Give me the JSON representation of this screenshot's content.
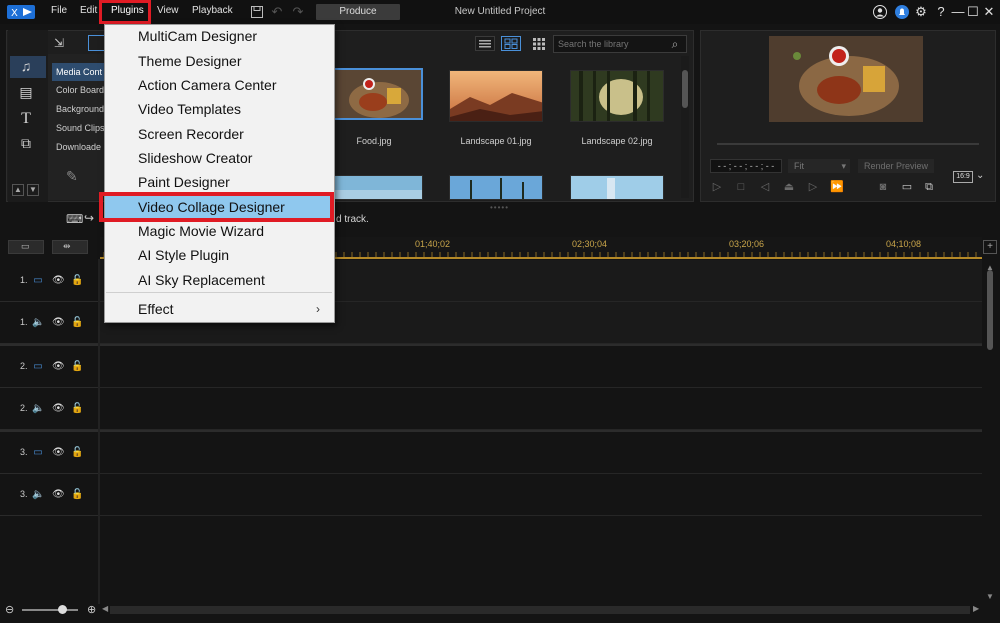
{
  "menubar": {
    "items": [
      "File",
      "Edit",
      "Plugins",
      "View",
      "Playback"
    ],
    "produce_label": "Produce",
    "project_title": "New Untitled Project"
  },
  "plugins_menu": {
    "items": [
      "MultiCam Designer",
      "Theme Designer",
      "Action Camera Center",
      "Video Templates",
      "Screen Recorder",
      "Slideshow Creator",
      "Paint Designer",
      "Video Collage Designer",
      "Magic Movie Wizard",
      "AI Style Plugin",
      "AI Sky Replacement"
    ],
    "selected": "Video Collage Designer",
    "submenu_label": "Effect",
    "submenu_arrow": "›"
  },
  "library": {
    "categories": [
      "Media Cont",
      "Color Board",
      "Background",
      "Sound Clips",
      "Downloade"
    ],
    "search_placeholder": "Search the library",
    "thumbs": [
      {
        "caption": "Food.jpg"
      },
      {
        "caption": "Landscape 01.jpg"
      },
      {
        "caption": "Landscape 02.jpg"
      }
    ],
    "hint": "d track."
  },
  "preview": {
    "timecode": "- - ; - - ; - - ; - -",
    "fit_label": "Fit",
    "render_label": "Render Preview",
    "ratio_label": "16:9"
  },
  "timeline": {
    "tick_labels": [
      "01;40;02",
      "02;30;04",
      "03;20;06",
      "04;10;08"
    ],
    "tracks": [
      {
        "num": "1.",
        "type": "video"
      },
      {
        "num": "1.",
        "type": "audio"
      },
      {
        "num": "2.",
        "type": "video"
      },
      {
        "num": "2.",
        "type": "audio"
      },
      {
        "num": "3.",
        "type": "video"
      },
      {
        "num": "3.",
        "type": "audio"
      }
    ]
  },
  "colors": {
    "accent": "#4a90d9",
    "highlight_red": "#e01b24",
    "menu_selected": "#8fc8ee",
    "ruler": "#b58a28"
  }
}
